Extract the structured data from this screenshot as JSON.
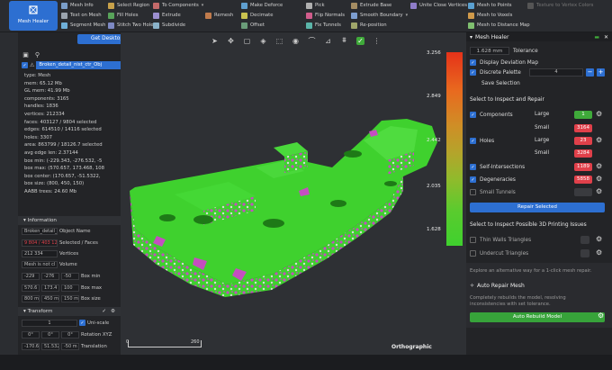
{
  "toolbar": {
    "app_label": "Mesh Healer",
    "col1": [
      "Mesh Info",
      "Text on Mesh",
      "Segment Mesh"
    ],
    "col2": [
      "Select Region",
      "Fill Holes",
      "Stitch Two Holes"
    ],
    "col3": [
      "To Components",
      "Extrude",
      "Remesh",
      "Subdivide"
    ],
    "col4": [
      "Make Deforce",
      "Decimate",
      "Offset"
    ],
    "col5": [
      "Pick",
      "Flip Normals",
      "Fix Tunnels"
    ],
    "col6": [
      "Extrude Base",
      "Smooth Boundary",
      "Re-position"
    ],
    "col7": [
      "Unite Close Vertices"
    ],
    "col8": [
      "Mesh to Points",
      "Mesh to Voxels",
      "Mesh to Distance Map"
    ],
    "col9": [
      "Texture to Vertex Colors"
    ]
  },
  "left": {
    "get_desktop": "Get Desktop",
    "object_name": "Broken_detail_nist_ctr_Obj",
    "stats": [
      "type: Mesh",
      "mem: 65.12 Mb",
      "GL mem: 41.99 Mb",
      "components: 3165",
      "handles: 1836",
      "vertices: 212334",
      "faces: 403127 / 9804 selected",
      "edges: 614510 / 14116 selected",
      "holes: 3307",
      "area: 863799 / 18126.7 selected",
      "avg edge len: 2.37144",
      "box min: (-229.343, -276.532, -5",
      "box max: (570.657, 173.468, 108",
      "box center: (170.657, -51.5322,",
      "box size: (800, 450, 150)",
      "AABB trees: 24.60 Mb"
    ],
    "info_title": "Information",
    "info_name": "Broken_detail_nist_ctr",
    "info_name_label": "Object Name",
    "selected_faces": "9 804 / 403 12",
    "selected_faces_label": "Selected / Faces",
    "vertices": "212 334",
    "vertices_label": "Vertices",
    "volume": "Mesh is not cl",
    "volume_label": "Volume",
    "box_min": [
      "-229",
      "-276",
      "-50"
    ],
    "box_min_label": "Box min",
    "box_max": [
      "570.6",
      "173.4",
      "100"
    ],
    "box_max_label": "Box max",
    "box_size": [
      "800 m",
      "450 m",
      "150 m"
    ],
    "box_size_label": "Box size",
    "transform_title": "Transform",
    "scale_value": "1",
    "uni_scale": "Uni-scale",
    "rotation": [
      "0°",
      "0°",
      "0°"
    ],
    "rotation_label": "Rotation XYZ",
    "translation": [
      "-170.6",
      "51.532",
      "-50 m"
    ],
    "translation_label": "Translation"
  },
  "viewport": {
    "colorbar_labels": [
      "3.256",
      "2.849",
      "2.442",
      "2.035",
      "1.628"
    ],
    "scale_start": "0",
    "scale_end": "260",
    "projection": "Orthographic"
  },
  "right": {
    "title": "Mesh Healer",
    "tolerance_value": "1.628 mm",
    "tolerance_label": "Tolerance",
    "display_deviation": "Display Deviation Map",
    "discrete_palette": "Discrete Palette",
    "palette_value": "4",
    "save_selection": "Save Selection",
    "section1": "Select to Inspect and Repair",
    "components": "Components",
    "large": "Large",
    "small": "Small",
    "components_large": "1",
    "components_small": "3164",
    "holes": "Holes",
    "holes_large": "23",
    "holes_small": "3284",
    "self_intersections": "Self-Intersections",
    "self_intersections_count": "1189",
    "degeneracies": "Degeneracies",
    "degeneracies_count": "5858",
    "small_tunnels": "Small Tunnels",
    "repair_selected": "Repair Selected",
    "section2": "Select to Inspect Possible 3D Printing Issues",
    "thin_walls": "Thin Walls Triangles",
    "undercut": "Undercut Triangles",
    "explore_text": "Explore an alternative way for a 1-click mesh repair.",
    "auto_repair_title": "Auto Repair Mesh",
    "auto_repair_desc": "Completely rebuilds the model, resolving inconsistencies with set tolerance.",
    "auto_rebuild": "Auto Rebuild Model"
  },
  "colors": {
    "accent_blue": "#2d6fd1",
    "mesh_green": "#3fd12e",
    "defect_magenta": "#c44fc0",
    "count_red": "#e0404a",
    "count_green": "#3faa3a"
  }
}
